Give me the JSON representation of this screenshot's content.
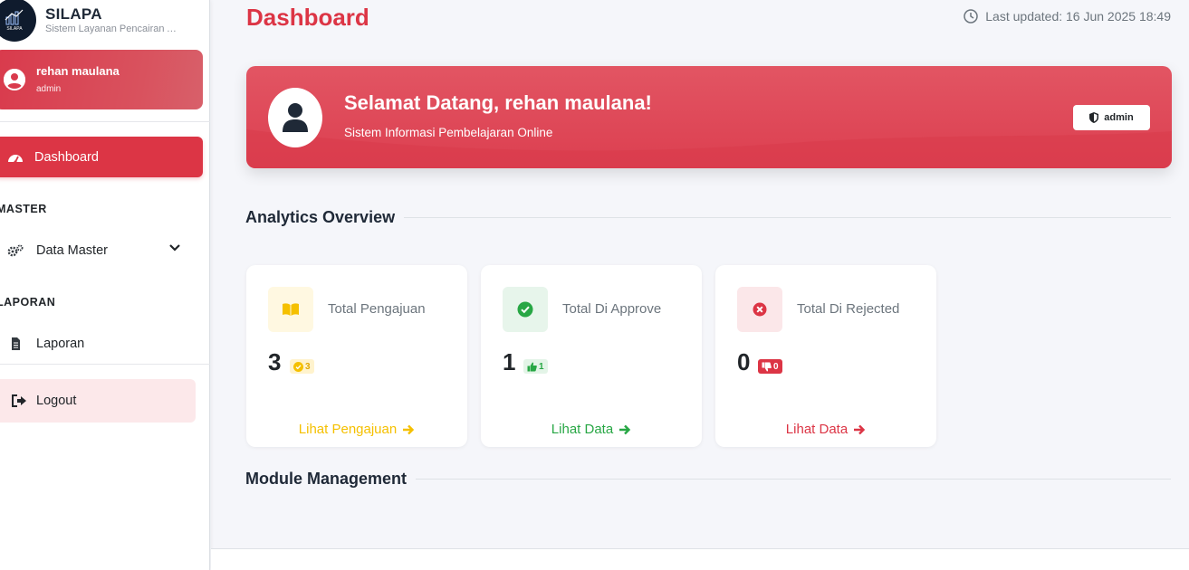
{
  "brand": {
    "title": "SILAPA",
    "subtitle": "Sistem Layanan Pencairan Anggaran",
    "logo_text": "SILAPA"
  },
  "user": {
    "name": "rehan maulana",
    "role": "admin"
  },
  "nav": {
    "dashboard": "Dashboard",
    "section_master": "MASTER",
    "data_master": "Data Master",
    "section_laporan": "LAPORAN",
    "laporan": "Laporan",
    "logout": "Logout"
  },
  "header": {
    "title": "Dashboard",
    "last_updated": "Last updated: 16 Jun 2025 18:49"
  },
  "banner": {
    "welcome": "Selamat Datang, rehan maulana!",
    "subtitle": "Sistem Informasi Pembelajaran Online",
    "role_badge": "admin"
  },
  "sections": {
    "analytics": "Analytics Overview",
    "modules": "Module Management"
  },
  "cards": [
    {
      "label": "Total Pengajuan",
      "value": "3",
      "pill": "3",
      "link": "Lihat Pengajuan",
      "accent": "#f5c000",
      "bg": "#fff8e1"
    },
    {
      "label": "Total Di Approve",
      "value": "1",
      "pill": "1",
      "link": "Lihat Data",
      "accent": "#28a745",
      "bg": "#e7f5eb"
    },
    {
      "label": "Total Di Rejected",
      "value": "0",
      "pill": "0",
      "link": "Lihat Data",
      "accent": "#dc3545",
      "bg": "#fbe7e9"
    }
  ],
  "colors": {
    "primary": "#dc3545",
    "warning": "#f5c000",
    "success": "#28a745"
  }
}
